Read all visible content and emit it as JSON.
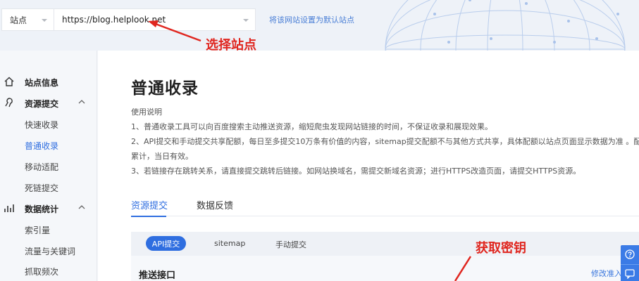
{
  "topbar": {
    "site_label": "站点",
    "url_value": "https://blog.helplook.net",
    "set_default": "将该网站设置为默认站点"
  },
  "annotations": {
    "select_site": "选择站点",
    "get_key": "获取密钥",
    "color": "#e0261f"
  },
  "sidebar": {
    "groups": [
      {
        "label": "站点信息",
        "icon": "home-icon"
      },
      {
        "label": "资源提交",
        "icon": "submit-icon"
      },
      {
        "label": "数据统计",
        "icon": "stats-icon"
      }
    ],
    "items": [
      "快速收录",
      "普通收录",
      "移动适配",
      "死链提交",
      "索引量",
      "流量与关键词",
      "抓取频次"
    ],
    "active_item": "普通收录"
  },
  "main": {
    "title": "普通收录",
    "desc": {
      "heading": "使用说明",
      "line1": "1、普通收录工具可以向百度搜索主动推送资源，缩短爬虫发现网站链接的时间，不保证收录和展现效果。",
      "line2": "2、API提交和手动提交共享配额，每日至多提交10万条有价值的内容，sitemap提交配额不与其他方式共享，具体配额以站点页面显示数据为准 。配额不可",
      "line2b": "累计，当日有效。",
      "line3": "3、若链接存在跳转关系，请直接提交跳转后链接。如网站换域名，需提交新域名资源；进行HTTPS改造页面，请提交HTTPS资源。"
    },
    "tabs": [
      "资源提交",
      "数据反馈"
    ],
    "subtabs": [
      "API提交",
      "sitemap",
      "手动提交"
    ],
    "section_title": "推送接口",
    "edit_link": "修改准入"
  },
  "colors": {
    "accent": "#2f6ee0",
    "link": "#4a7fd6"
  }
}
